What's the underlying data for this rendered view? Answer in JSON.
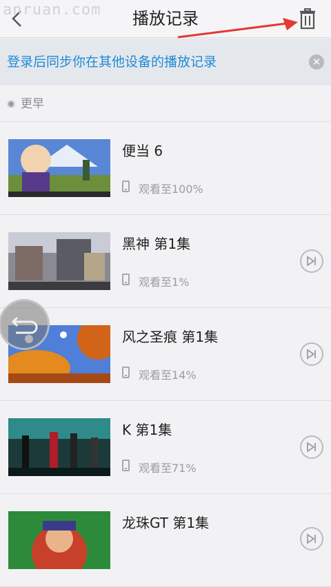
{
  "watermark": "anruan.com",
  "header": {
    "title": "播放记录",
    "back_icon": "chevron-left-icon",
    "trash_icon": "trash-icon"
  },
  "sync_banner": {
    "text": "登录后同步你在其他设备的播放记录",
    "close_icon": "close-icon"
  },
  "section": {
    "label": "更早"
  },
  "items": [
    {
      "title": "便当 6",
      "progress": "观看至100%",
      "has_play_next": false
    },
    {
      "title": "黑神 第1集",
      "progress": "观看至1%",
      "has_play_next": true
    },
    {
      "title": "风之圣痕 第1集",
      "progress": "观看至14%",
      "has_play_next": true
    },
    {
      "title": "K 第1集",
      "progress": "观看至71%",
      "has_play_next": true
    },
    {
      "title": "龙珠GT 第1集",
      "progress": "",
      "has_play_next": true
    }
  ],
  "colors": {
    "accent": "#1f8ad6",
    "arrow": "#e53935",
    "background": "#f2f2f4"
  }
}
